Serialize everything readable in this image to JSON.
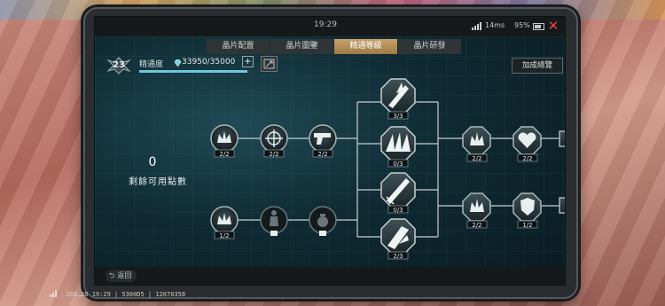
{
  "status_bar": {
    "time": "19:29",
    "ping": "14ms",
    "battery": "95%"
  },
  "tabs": [
    {
      "label": "晶片配置",
      "active": false
    },
    {
      "label": "晶片圖鑒",
      "active": false
    },
    {
      "label": "精通等級",
      "active": true
    },
    {
      "label": "晶片研發",
      "active": false
    }
  ],
  "proficiency": {
    "level": "23",
    "label": "精通度",
    "value": "33950/35000",
    "current": 33950,
    "max": 35000
  },
  "summary_button": "加成總覽",
  "available_points": {
    "count": "0",
    "label": "剩餘可用點數"
  },
  "nodes": [
    {
      "icon": "crown-crystal-icon",
      "progress": "2/2",
      "locked": false
    },
    {
      "icon": "crosshair-icon",
      "progress": "2/2",
      "locked": false
    },
    {
      "icon": "pistol-icon",
      "progress": "2/2",
      "locked": false
    },
    {
      "icon": "crown-crystal-icon",
      "progress": "1/2",
      "locked": false
    },
    {
      "icon": "soldier-icon",
      "progress": "",
      "locked": true
    },
    {
      "icon": "grenade-icon",
      "progress": "",
      "locked": true
    },
    {
      "icon": "flame-blade-icon",
      "progress": "3/3",
      "locked": false
    },
    {
      "icon": "claw-slash-icon",
      "progress": "0/3",
      "locked": false
    },
    {
      "icon": "sword-icon",
      "progress": "0/3",
      "locked": false
    },
    {
      "icon": "wind-shard-icon",
      "progress": "2/3",
      "locked": false
    },
    {
      "icon": "crown-crystal-icon",
      "progress": "2/2",
      "locked": false
    },
    {
      "icon": "heart-shield-icon",
      "progress": "2/2",
      "locked": false
    },
    {
      "icon": "crown-crystal-icon",
      "progress": "2/2",
      "locked": false
    },
    {
      "icon": "shield-icon",
      "progress": "1/2",
      "locked": false
    }
  ],
  "back_button": "返回",
  "footer": {
    "text": " 202…28 19:29 | 5300D5 | 12070358"
  },
  "colors": {
    "accent_tab": "#c8a26a",
    "bar_fill": "#6fc8d6",
    "close": "#e14b3b"
  }
}
